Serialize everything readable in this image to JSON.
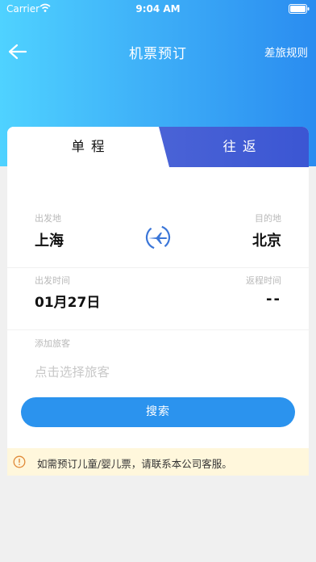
{
  "status": {
    "carrier": "Carrier",
    "time": "9:04 AM"
  },
  "nav": {
    "title": "机票预订",
    "rules": "差旅规则"
  },
  "tabs": {
    "one_way": "单程",
    "round_trip": "往返"
  },
  "route": {
    "from_label": "出发地",
    "from_city": "上海",
    "to_label": "目的地",
    "to_city": "北京"
  },
  "dates": {
    "depart_label": "出发时间",
    "depart_value": "01月27日",
    "return_label": "返程时间",
    "return_value": "--"
  },
  "passengers": {
    "label": "添加旅客",
    "placeholder": "点击选择旅客"
  },
  "search": {
    "label": "搜索"
  },
  "notice": {
    "text": "如需预订儿童/婴儿票，请联系本公司客服。"
  },
  "colors": {
    "accent": "#2b93ee",
    "tab_blue": "#3b56d3",
    "notice_bg": "#fff7dc",
    "warning": "#e08a39"
  }
}
